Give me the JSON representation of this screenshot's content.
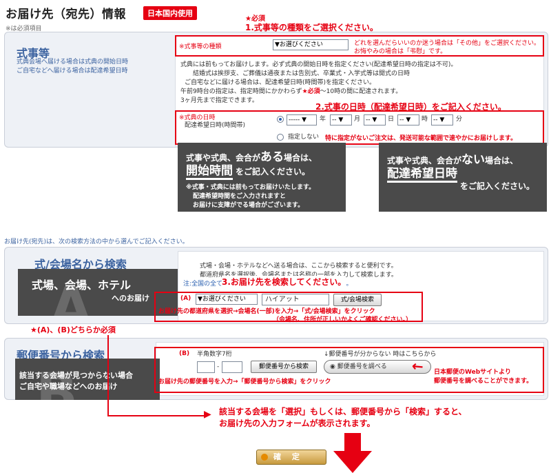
{
  "header": {
    "title": "お届け先（宛先）情報",
    "badge": "日本国内使用",
    "required_note": "※は必須項目"
  },
  "ceremony": {
    "required_mark": "★必須",
    "step1": "1.式事等の種類をご選択ください。",
    "section_title": "式事等",
    "section_desc1": "式典会場へ届ける場合は式典の開始日時",
    "section_desc2": "ご自宅などへ届ける場合は配達希望日時",
    "type_label": "※式事等の種類",
    "type_select": "▼お選びください",
    "type_hint1": "どれを選んだらいいのか迷う場合は「その他」をご選択ください。",
    "type_hint2": "お悔やみの場合は「弔慰」です。",
    "info1": "式典には前もってお届けします。必ず式典の開始日時を指定ください(配達希望日時の指定は不可)。",
    "info2": "結婚式は挨拶支、ご葬儀は通夜または告別式、卒業式・入学式等は開式の日時",
    "info3": "ご自宅などに届ける場合は、配達希望日時(時間帯)を指定ください。",
    "info4a": "午前9時台の指定は、指定時間にかかわらず",
    "info4_req": "★必須",
    "info4b": "～10時の間に配達されます。",
    "info5": "3ヶ月先まで指定できます。",
    "step2": "2.式事の日時（配達希望日時）をご記入ください。",
    "datetime_label1": "※式典の日時",
    "datetime_label2": "配達希望日時(時間帯)",
    "year_sel": "----- ▼",
    "year_unit": "年",
    "month_sel": "-- ▼",
    "month_unit": "月",
    "day_sel": "-- ▼",
    "day_unit": "日",
    "hour_sel": "-- ▼",
    "hour_unit": "時",
    "min_sel": "-- ▼",
    "min_unit": "分",
    "no_spec_label": "指定しない",
    "no_spec_note": "特に指定がないご注文は、発送可能な範囲で速やかにお届けします。"
  },
  "dark_left": {
    "line1": "式事や式典、会合が",
    "line1_em": "ある",
    "line1_tail": "場合は、",
    "line2_em": "開始時間",
    "line2_tail": "をご記入ください。",
    "note1": "※式事・式典には前もってお届けいたします。",
    "note2": "配達希望時間をご入力されますと",
    "note3": "お届けに支障がでる場合がございます。"
  },
  "dark_right": {
    "line1": "式事や式典、会合が",
    "line1_em": "ない",
    "line1_tail": "場合は、",
    "line2_em": "配達希望日時",
    "line3": "をご記入ください。"
  },
  "search_intro": "お届け先(宛先)は、次の検索方法の中から選んでご記入ください。",
  "venue": {
    "title": "式/会場名から検索",
    "desc1": "式場・会場・ホテルなどへ送る場合は、ここから検索すると便利です。",
    "desc2": "都道府県名を選択後、会場名または名称の一部を入力して検索します。",
    "desc3": "注:全国の全ての会場が登録されているわけではありません。",
    "step3": "3.お届け先を検索してください。",
    "overlay_title": "式場、会場、ホテル",
    "overlay_sub": "へのお届け",
    "letter": "A",
    "mark": "(A)",
    "pref_select": "▼お選びください",
    "name_value": "ハイアット",
    "search_button": "式/会場検索",
    "guide1": "お届け先の都道府県を選択→会場名(一部)を入力→「式/会場検索」をクリック",
    "guide2": "（会場名、住所が正しいかよくご確認ください。）"
  },
  "either_required": "★(A)、(B)どちらか必須",
  "postal": {
    "title": "郵便番号から検索",
    "overlay1": "該当する会場が見つからない場合",
    "overlay2": "ご自宅や職場などへのお届け",
    "letter": "B",
    "mark": "(B)",
    "digits_note": "半角数字7桁",
    "unknown_note": "↓郵便番号が分からない 時はこちらから",
    "dash": "-",
    "search_button": "郵便番号から検索",
    "lookup_button": "郵便番号を調べる",
    "guide": "お届け先の郵便番号を入力→「郵便番号から検索」をクリック",
    "jp_post1": "日本郵便のWebサイトより",
    "jp_post2": "郵便番号を調べることができます。"
  },
  "result_note1": "該当する会場を「選択」もしくは、郵便番号から「検索」すると、",
  "result_note2": "お届け先の入力フォームが表示されます。",
  "confirm_label": "確 定",
  "colors": {
    "accent_red": "#e60012",
    "section_blue": "#3c63a0",
    "dark_box": "#4a4a4a",
    "panel_bg": "#eef1f6"
  }
}
